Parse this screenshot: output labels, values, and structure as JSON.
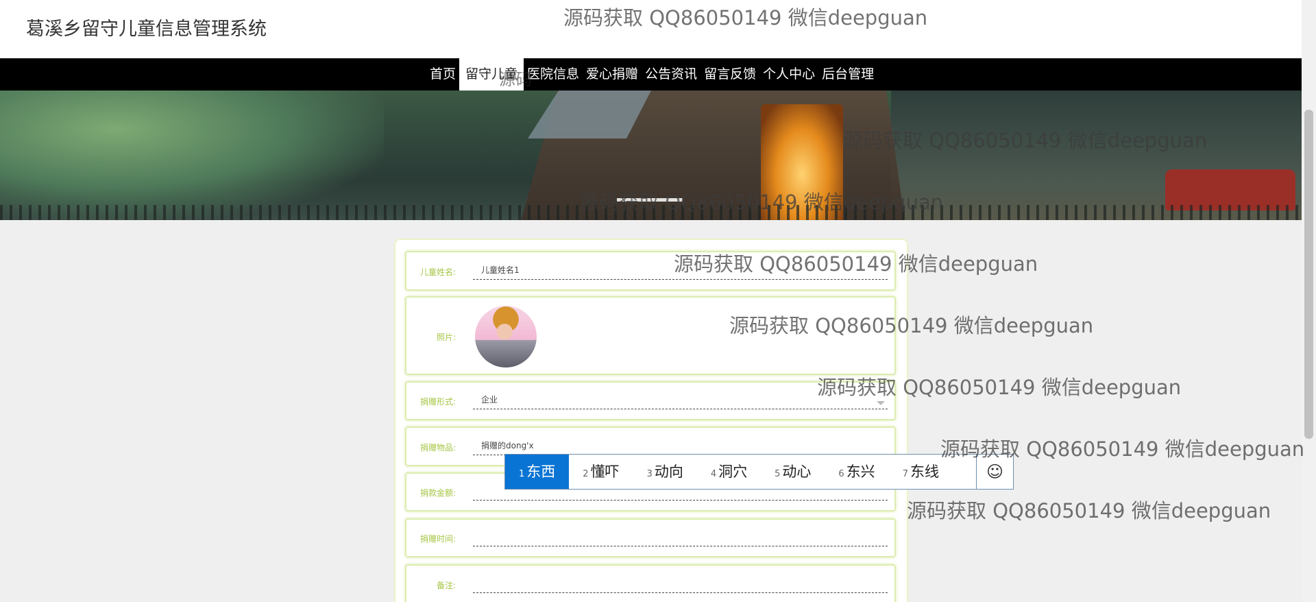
{
  "header": {
    "title": "葛溪乡留守儿童信息管理系统"
  },
  "nav": {
    "items": [
      {
        "label": "首页"
      },
      {
        "label": "留守儿童"
      },
      {
        "label": "医院信息"
      },
      {
        "label": "爱心捐赠"
      },
      {
        "label": "公告资讯"
      },
      {
        "label": "留言反馈"
      },
      {
        "label": "个人中心"
      },
      {
        "label": "后台管理"
      }
    ]
  },
  "form": {
    "child_name": {
      "label": "儿童姓名:",
      "value": "儿童姓名1"
    },
    "photo": {
      "label": "照片:"
    },
    "donation_type": {
      "label": "捐赠形式:",
      "value": "企业"
    },
    "donation_item": {
      "label": "捐赠物品:",
      "value": "捐赠的dong'x"
    },
    "donation_amount": {
      "label": "捐款金额:",
      "value": ""
    },
    "donation_time": {
      "label": "捐赠时间:",
      "value": ""
    },
    "remark": {
      "label": "备注:",
      "value": ""
    }
  },
  "ime": {
    "candidates": [
      {
        "num": "1",
        "text": "东西"
      },
      {
        "num": "2",
        "text": "懂吓"
      },
      {
        "num": "3",
        "text": "动向"
      },
      {
        "num": "4",
        "text": "洞穴"
      },
      {
        "num": "5",
        "text": "动心"
      },
      {
        "num": "6",
        "text": "东兴"
      },
      {
        "num": "7",
        "text": "东线"
      }
    ],
    "emoji_symbol": "☺"
  },
  "watermark": {
    "text": "源码获取 QQ86050149 微信deepguan",
    "fragment": "源码"
  }
}
